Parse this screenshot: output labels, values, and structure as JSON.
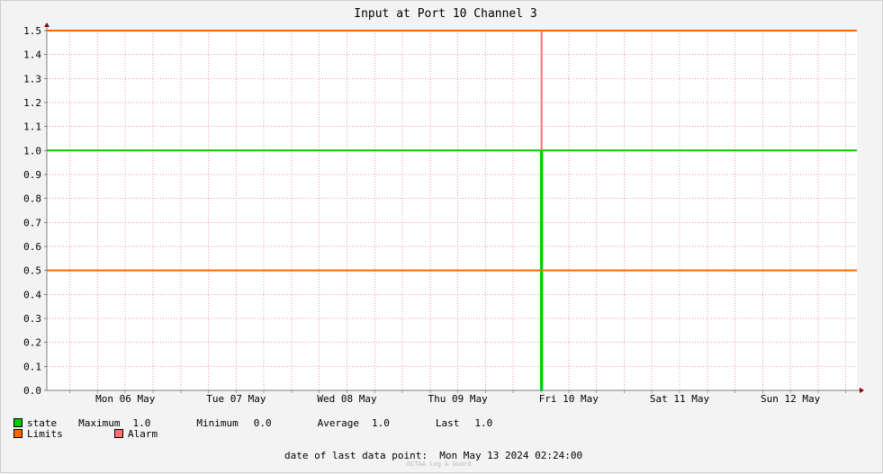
{
  "chart_data": {
    "type": "line",
    "title": "Input at Port 10 Channel 3",
    "xlabel": "",
    "ylabel": "",
    "ylim": [
      0.0,
      1.5
    ],
    "yticks": [
      "0.0",
      "0.1",
      "0.2",
      "0.3",
      "0.4",
      "0.5",
      "0.6",
      "0.7",
      "0.8",
      "0.9",
      "1.0",
      "1.1",
      "1.2",
      "1.3",
      "1.4",
      "1.5"
    ],
    "xlim": [
      "2024-05-05 19:00",
      "2024-05-13 02:24"
    ],
    "xtick_labels": [
      "Mon 06 May",
      "Tue 07 May",
      "Wed 08 May",
      "Thu 09 May",
      "Fri 10 May",
      "Sat 11 May",
      "Sun 12 May"
    ],
    "grid": true,
    "series": [
      {
        "name": "state",
        "color": "#00cc00",
        "points": [
          {
            "x": "2024-05-05 19:00",
            "y": 1.0
          },
          {
            "x": "2024-05-10 06:00",
            "y": 1.0
          },
          {
            "x": "2024-05-10 06:00",
            "y": 0.0
          },
          {
            "x": "2024-05-10 06:15",
            "y": 0.0
          },
          {
            "x": "2024-05-10 06:15",
            "y": 1.0
          },
          {
            "x": "2024-05-13 02:24",
            "y": 1.0
          }
        ]
      },
      {
        "name": "Limits",
        "color": "#ff6600",
        "lines": [
          1.5,
          0.5
        ]
      },
      {
        "name": "Alarm",
        "color": "#ff7070",
        "points": [
          {
            "x": "2024-05-10 06:08",
            "y": 1.0
          },
          {
            "x": "2024-05-10 06:08",
            "y": 1.5
          }
        ]
      }
    ]
  },
  "legend": {
    "state_label": "state",
    "max_label": "Maximum",
    "max_value": "1.0",
    "min_label": "Minimum",
    "min_value": "0.0",
    "avg_label": "Average",
    "avg_value": "1.0",
    "last_label": "Last",
    "last_value": "1.0",
    "limits_label": "Limits",
    "alarm_label": "Alarm"
  },
  "footer": {
    "last_point_label": "date of last data point:",
    "last_point_value": "Mon May 13 2024 02:24:00",
    "watermark": "OCTAA Log & Guard"
  }
}
